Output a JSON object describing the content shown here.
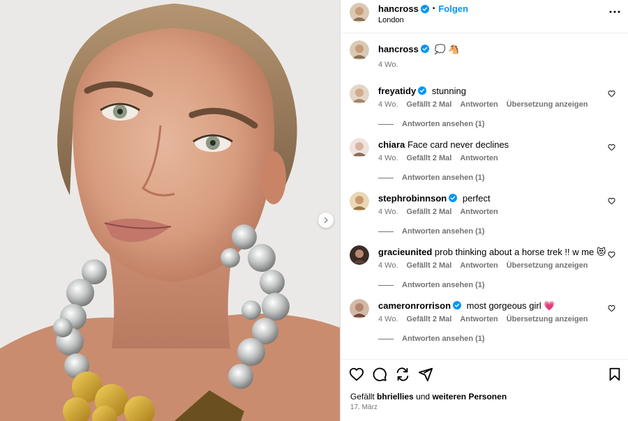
{
  "header": {
    "username": "hancross",
    "dot": "•",
    "follow_label": "Folgen",
    "location": "London"
  },
  "caption": {
    "username": "hancross",
    "text": "💭 🐴",
    "time": "4 Wo."
  },
  "comments": [
    {
      "username": "freyatidy",
      "verified": true,
      "text": "stunning",
      "time": "4 Wo.",
      "likes": "Gefällt 2 Mal",
      "reply": "Antworten",
      "translate": "Übersetzung anzeigen",
      "view_replies": "Antworten ansehen (1)"
    },
    {
      "username": "chiara",
      "verified": false,
      "text": "Face card never declines",
      "time": "4 Wo.",
      "likes": "Gefällt 2 Mal",
      "reply": "Antworten",
      "translate": "",
      "view_replies": "Antworten ansehen (1)"
    },
    {
      "username": "stephrobinnson",
      "verified": true,
      "text": "perfect",
      "time": "4 Wo.",
      "likes": "Gefällt 2 Mal",
      "reply": "Antworten",
      "translate": "",
      "view_replies": "Antworten ansehen (1)"
    },
    {
      "username": "gracieunited",
      "verified": false,
      "text": "prob thinking about a horse trek !! w me 😻",
      "time": "4 Wo.",
      "likes": "Gefällt 2 Mal",
      "reply": "Antworten",
      "translate": "Übersetzung anzeigen",
      "view_replies": "Antworten ansehen (1)"
    },
    {
      "username": "cameronrorrison",
      "verified": true,
      "text": "most gorgeous girl 💗",
      "time": "4 Wo.",
      "likes": "Gefällt 2 Mal",
      "reply": "Antworten",
      "translate": "Übersetzung anzeigen",
      "view_replies": "Antworten ansehen (1)"
    }
  ],
  "footer": {
    "liked_prefix": "Gefällt",
    "liked_user": "bhriellies",
    "liked_and": "und",
    "liked_rest": "weiteren Personen",
    "date": "17. März"
  },
  "icons": [
    "heart-icon",
    "comment-icon",
    "share-icon",
    "send-icon",
    "bookmark-icon",
    "more-icon",
    "verified-icon",
    "chevron-right-icon"
  ],
  "colors": {
    "accent": "#0095f6",
    "muted": "#737373",
    "verified": "#0095f6"
  }
}
